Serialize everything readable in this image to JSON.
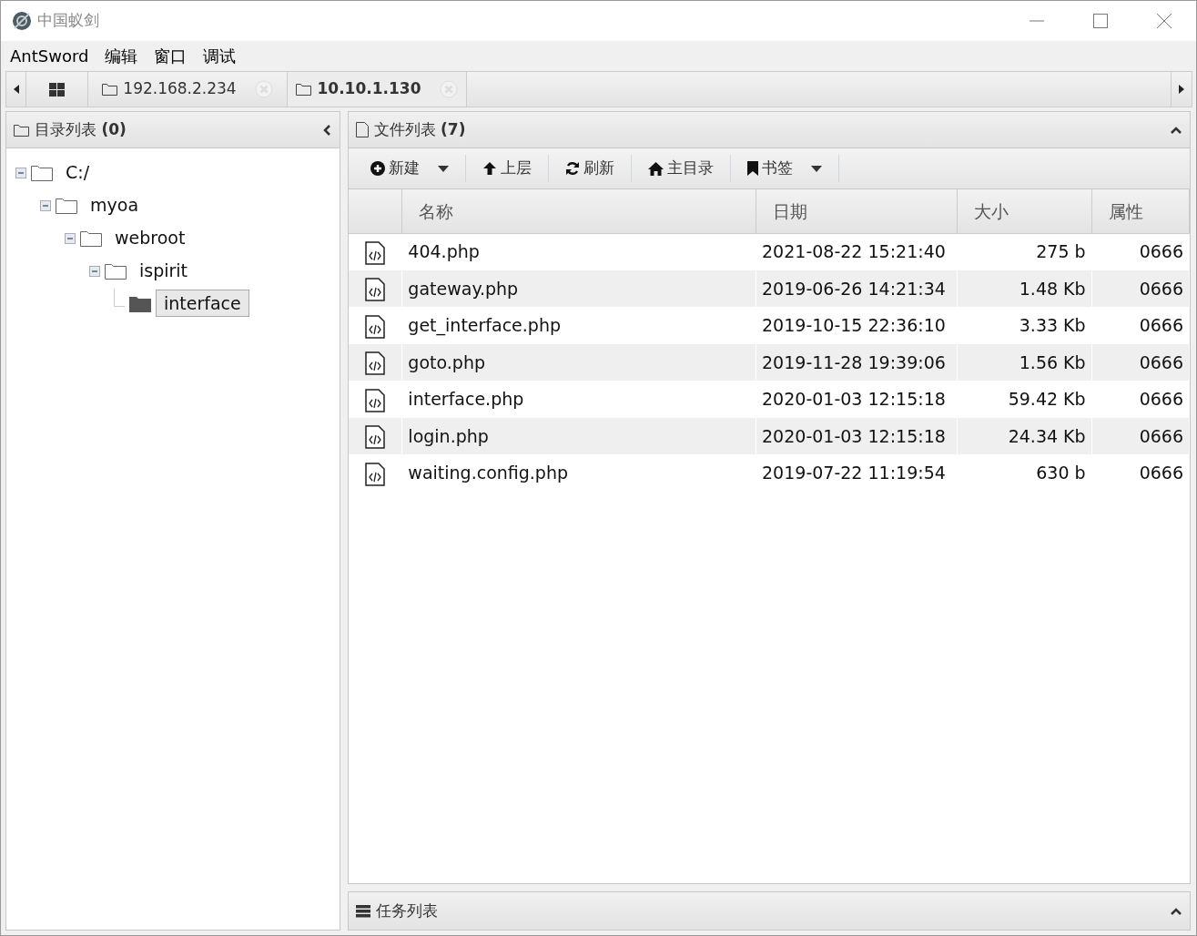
{
  "window": {
    "title": "中国蚁剑"
  },
  "menu": [
    "AntSword",
    "编辑",
    "窗口",
    "调试"
  ],
  "tabs": [
    {
      "label": "192.168.2.234",
      "selected": false
    },
    {
      "label": "10.10.1.130",
      "selected": true
    }
  ],
  "dir_panel": {
    "title": "目录列表 **(0)**",
    "tree": [
      {
        "label": "C:/",
        "expanded": true,
        "selected": false,
        "children": [
          {
            "label": "myoa",
            "expanded": true,
            "selected": false,
            "children": [
              {
                "label": "webroot",
                "expanded": true,
                "selected": false,
                "children": [
                  {
                    "label": "ispirit",
                    "expanded": true,
                    "selected": false,
                    "children": [
                      {
                        "label": "interface",
                        "selected": true
                      }
                    ]
                  }
                ]
              }
            ]
          }
        ]
      }
    ]
  },
  "file_panel": {
    "title": "文件列表 **(7)**",
    "toolbar": [
      {
        "label": "新建",
        "kind": "new",
        "dropdown": true
      },
      {
        "label": "上层",
        "kind": "up",
        "dropdown": false
      },
      {
        "label": "刷新",
        "kind": "refresh",
        "dropdown": false
      },
      {
        "label": "主目录",
        "kind": "home",
        "dropdown": false
      },
      {
        "label": "书签",
        "kind": "bookmark",
        "dropdown": true
      }
    ],
    "columns": [
      "名称",
      "日期",
      "大小",
      "属性"
    ],
    "rows": [
      [
        "404.php",
        "2021-08-22 15:21:40",
        "275 b",
        "0666"
      ],
      [
        "gateway.php",
        "2019-06-26 14:21:34",
        "1.48 Kb",
        "0666"
      ],
      [
        "get_interface.php",
        "2019-10-15 22:36:10",
        "3.33 Kb",
        "0666"
      ],
      [
        "goto.php",
        "2019-11-28 19:39:06",
        "1.56 Kb",
        "0666"
      ],
      [
        "interface.php",
        "2020-01-03 12:15:18",
        "59.42 Kb",
        "0666"
      ],
      [
        "login.php",
        "2020-01-03 12:15:18",
        "24.34 Kb",
        "0666"
      ],
      [
        "waiting.config.php",
        "2019-07-22 11:19:54",
        "630 b",
        "0666"
      ]
    ]
  },
  "task_panel": {
    "title": "任务列表"
  }
}
